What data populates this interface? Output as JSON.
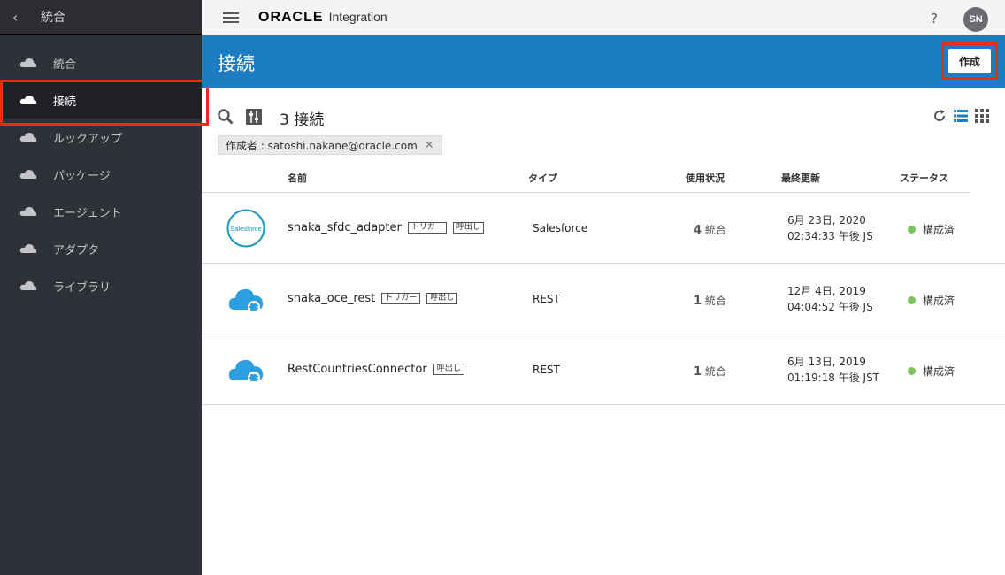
{
  "sidebar": {
    "back_icon": "chevron-left",
    "title": "統合",
    "items": [
      {
        "label": "統合",
        "icon": "cloud-icon",
        "active": false
      },
      {
        "label": "接続",
        "icon": "cloud-icon",
        "active": true
      },
      {
        "label": "ルックアップ",
        "icon": "cloud-icon",
        "active": false
      },
      {
        "label": "パッケージ",
        "icon": "cloud-icon",
        "active": false
      },
      {
        "label": "エージェント",
        "icon": "cloud-icon",
        "active": false
      },
      {
        "label": "アダプタ",
        "icon": "cloud-icon",
        "active": false
      },
      {
        "label": "ライブラリ",
        "icon": "cloud-icon",
        "active": false
      }
    ]
  },
  "topbar": {
    "logo_oracle": "ORACLE",
    "logo_product": "Integration",
    "help": "?",
    "avatar": "SN"
  },
  "page": {
    "title": "接続",
    "create_label": "作成"
  },
  "toolbar": {
    "count": "3 接続"
  },
  "filter_chip": {
    "label": "作成者 : satoshi.nakane@oracle.com"
  },
  "table": {
    "headers": [
      "名前",
      "タイプ",
      "使用状況",
      "最終更新",
      "ステータス"
    ],
    "rows": [
      {
        "icon": "salesforce-icon",
        "icon_text": "Salesforce",
        "name": "snaka_sfdc_adapter",
        "tags": [
          "トリガー",
          "呼出し"
        ],
        "type": "Salesforce",
        "usage_count": "4",
        "usage_unit": "統合",
        "updated_line1": "6月 23日, 2020",
        "updated_line2": "02:34:33 午後 JS",
        "status": "構成済"
      },
      {
        "icon": "rest-cloud-icon",
        "name": "snaka_oce_rest",
        "tags": [
          "トリガー",
          "呼出し"
        ],
        "type": "REST",
        "usage_count": "1",
        "usage_unit": "統合",
        "updated_line1": "12月 4日, 2019",
        "updated_line2": "04:04:52 午後 JS",
        "status": "構成済"
      },
      {
        "icon": "rest-cloud-icon",
        "name": "RestCountriesConnector",
        "tags": [
          "呼出し"
        ],
        "type": "REST",
        "usage_count": "1",
        "usage_unit": "統合",
        "updated_line1": "6月 13日, 2019",
        "updated_line2": "01:19:18 午後 JST",
        "status": "構成済"
      }
    ]
  },
  "colors": {
    "banner": "#1c7dc3",
    "sidebar": "#2f3138",
    "status_green": "#7bc25a",
    "highlight": "#ee2b12"
  }
}
